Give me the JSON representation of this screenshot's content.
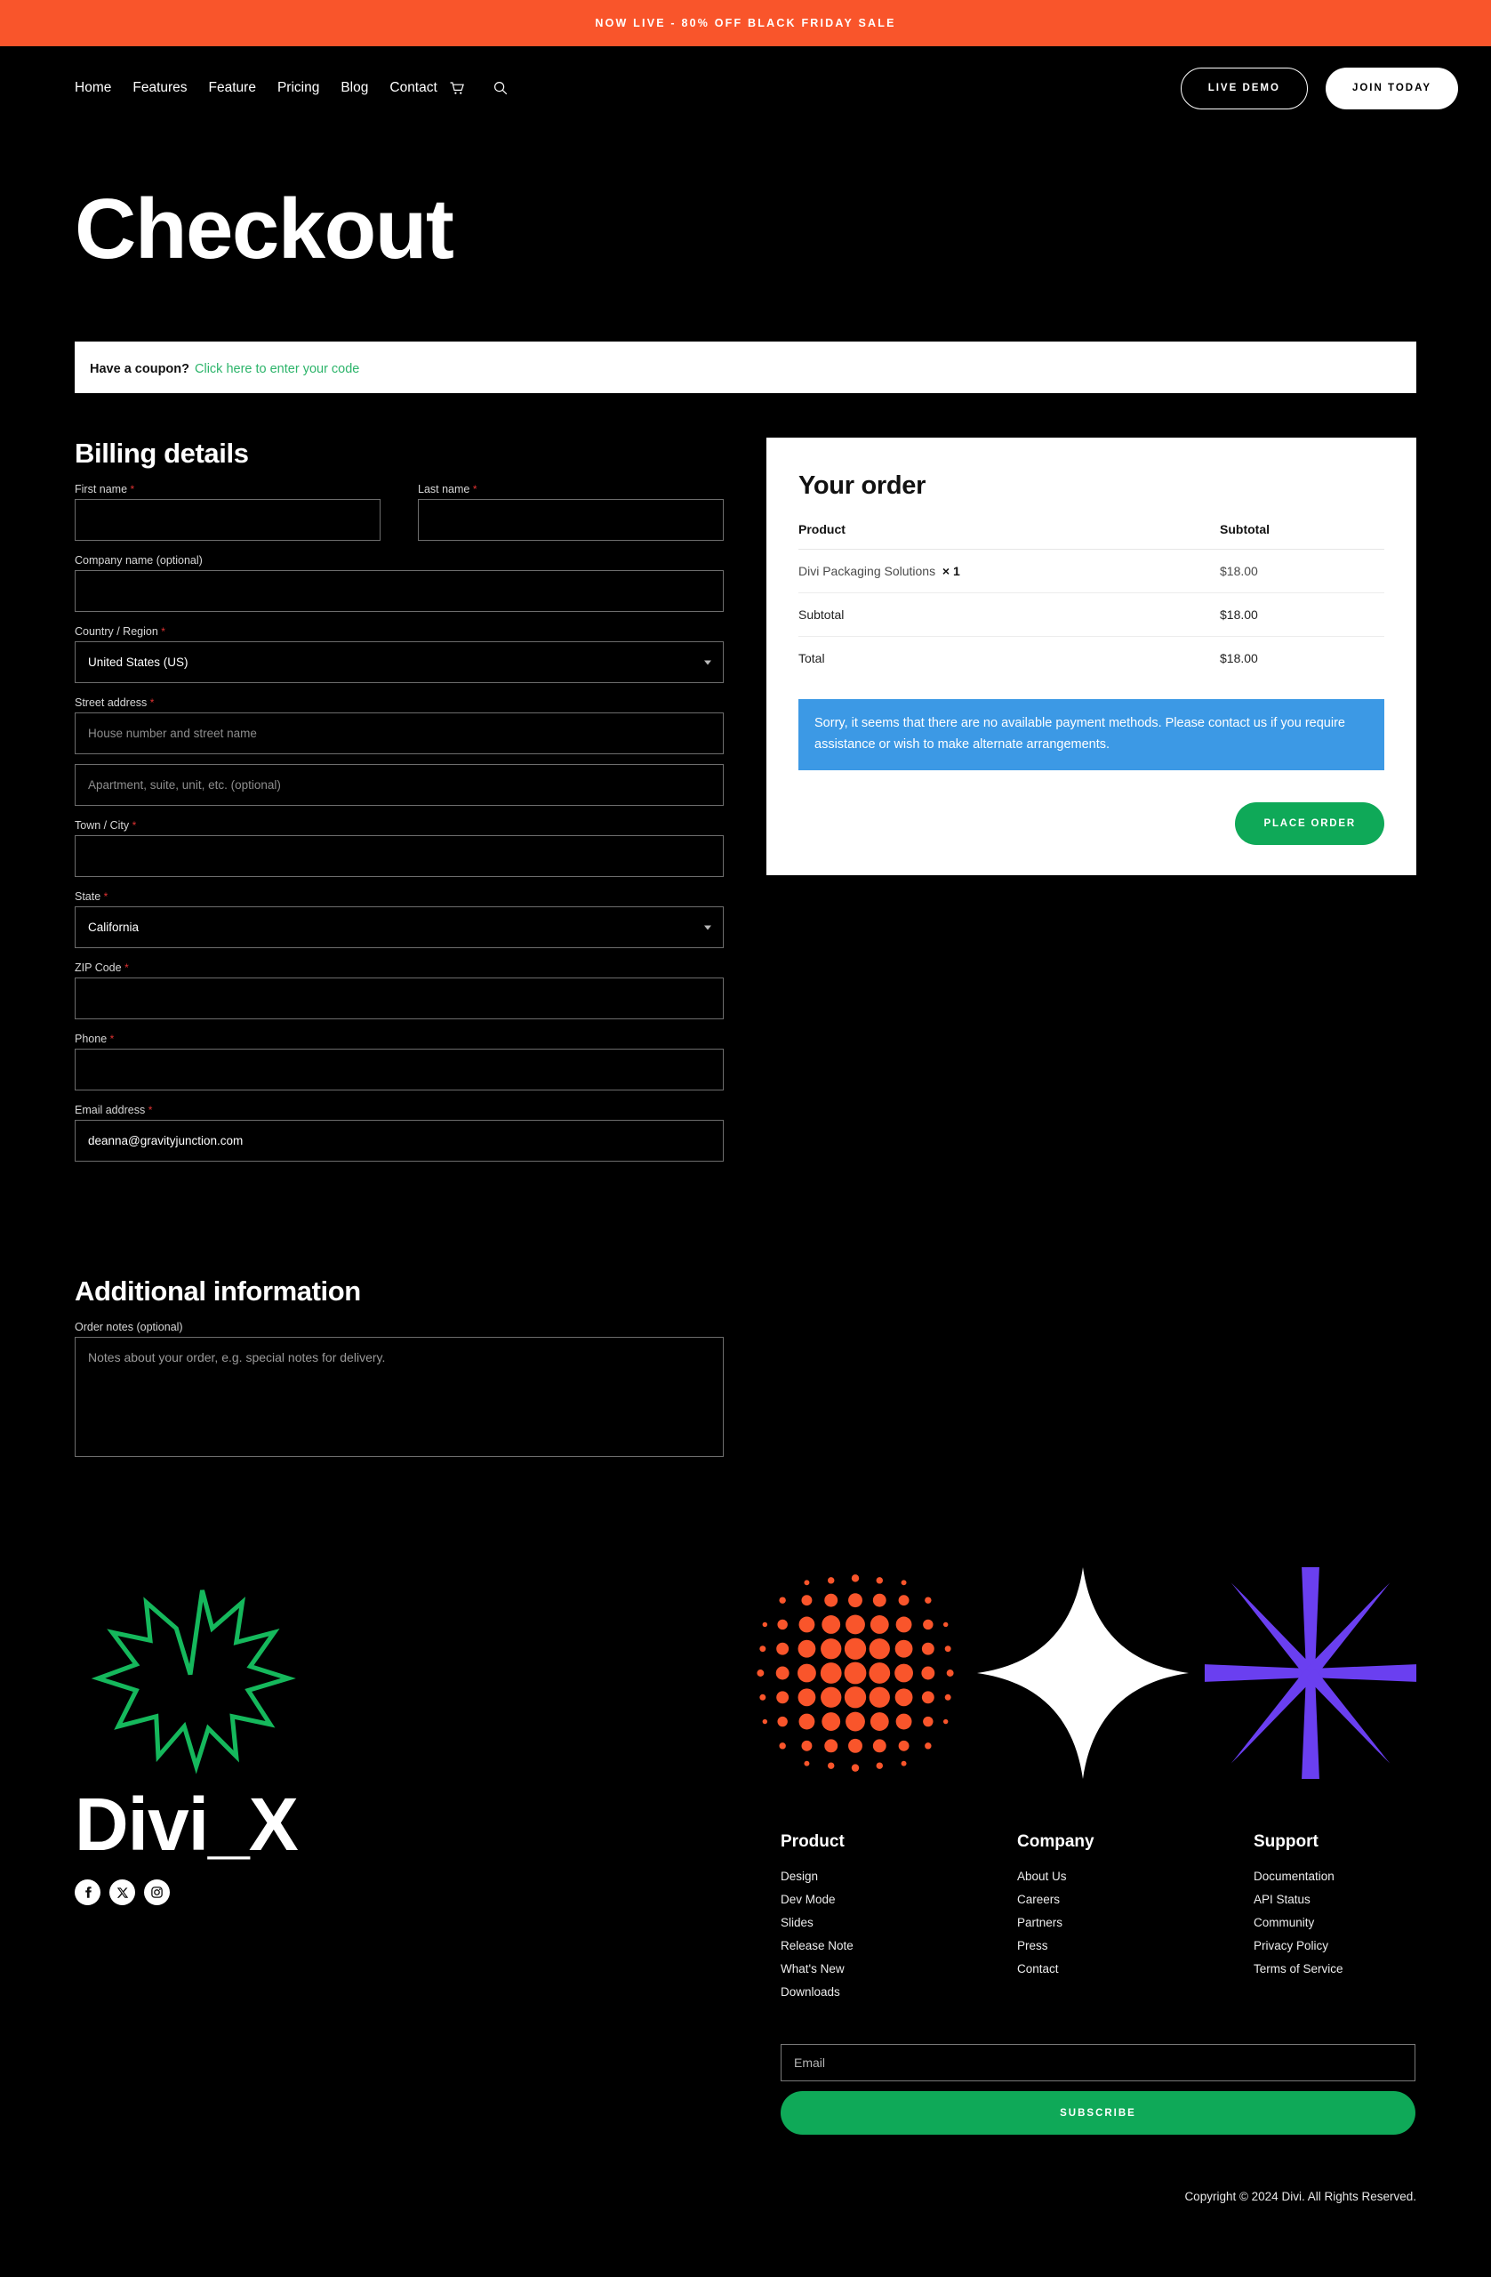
{
  "announcement": {
    "text": "NOW LIVE - 80% OFF BLACK FRIDAY SALE",
    "bg": "#F9552B"
  },
  "header": {
    "nav": [
      {
        "label": "Home"
      },
      {
        "label": "Features"
      },
      {
        "label": "Feature"
      },
      {
        "label": "Pricing"
      },
      {
        "label": "Blog"
      },
      {
        "label": "Contact"
      }
    ],
    "cart_icon": "shopping-cart-icon",
    "search_icon": "search-icon",
    "buttons": {
      "demo": "LIVE DEMO",
      "join": "JOIN TODAY"
    }
  },
  "hero": {
    "title": "Checkout"
  },
  "coupon": {
    "label": "Have a coupon?",
    "link": "Click here to enter your code",
    "link_color": "#2CB46A"
  },
  "billing": {
    "title": "Billing details",
    "first_name": {
      "label": "First name",
      "required": true,
      "value": "",
      "placeholder": ""
    },
    "last_name": {
      "label": "Last name",
      "required": true,
      "value": "",
      "placeholder": ""
    },
    "company": {
      "label": "Company name (optional)",
      "required": false,
      "value": "",
      "placeholder": ""
    },
    "country": {
      "label": "Country / Region",
      "required": true,
      "value": "United States (US)"
    },
    "street": {
      "label": "Street address",
      "required": true,
      "value": "",
      "placeholder": "House number and street name"
    },
    "street2": {
      "value": "",
      "placeholder": "Apartment, suite, unit, etc. (optional)"
    },
    "city": {
      "label": "Town / City",
      "required": true,
      "value": "",
      "placeholder": ""
    },
    "state": {
      "label": "State",
      "required": true,
      "value": "California"
    },
    "zip": {
      "label": "ZIP Code",
      "required": true,
      "value": "",
      "placeholder": ""
    },
    "phone": {
      "label": "Phone",
      "required": true,
      "value": "",
      "placeholder": ""
    },
    "email": {
      "label": "Email address",
      "required": true,
      "value": "deanna@gravityjunction.com",
      "placeholder": ""
    }
  },
  "additional": {
    "title": "Additional information",
    "notes_label": "Order notes (optional)",
    "notes_value": "",
    "notes_placeholder": "Notes about your order, e.g. special notes for delivery."
  },
  "order": {
    "title": "Your order",
    "columns": {
      "product": "Product",
      "subtotal": "Subtotal"
    },
    "items": [
      {
        "name": "Divi Packaging Solutions",
        "qty": "× 1",
        "subtotal": "$18.00"
      }
    ],
    "subtotal_label": "Subtotal",
    "subtotal_value": "$18.00",
    "total_label": "Total",
    "total_value": "$18.00",
    "notice": "Sorry, it seems that there are no available payment methods. Please contact us if you require assistance or wish to make alternate arrangements.",
    "notice_bg": "#3C99E5",
    "place_order": "PLACE ORDER",
    "place_order_bg": "#0FA958"
  },
  "footer": {
    "brand_name": "Divi_X",
    "logo_icon": "divi-flower-logo-icon",
    "logo_color": "#15B85C",
    "socials": [
      {
        "name": "facebook-icon"
      },
      {
        "name": "x-twitter-icon"
      },
      {
        "name": "instagram-icon"
      }
    ],
    "decor": [
      {
        "name": "orange-halftone-dots-graphic",
        "color": "#F9552B"
      },
      {
        "name": "white-four-point-star-graphic",
        "color": "#FFFFFF"
      },
      {
        "name": "purple-asterisk-burst-graphic",
        "color": "#6A3FF0"
      }
    ],
    "columns": [
      {
        "heading": "Product",
        "links": [
          "Design",
          "Dev Mode",
          "Slides",
          "Release Note",
          "What's New",
          "Downloads"
        ]
      },
      {
        "heading": "Company",
        "links": [
          "About Us",
          "Careers",
          "Partners",
          "Press",
          "Contact"
        ]
      },
      {
        "heading": "Support",
        "links": [
          "Documentation",
          "API Status",
          "Community",
          "Privacy Policy",
          "Terms of Service"
        ]
      }
    ],
    "subscribe": {
      "placeholder": "Email",
      "value": "",
      "button": "SUBSCRIBE"
    },
    "copyright": "Copyright © 2024 Divi. All Rights Reserved."
  }
}
